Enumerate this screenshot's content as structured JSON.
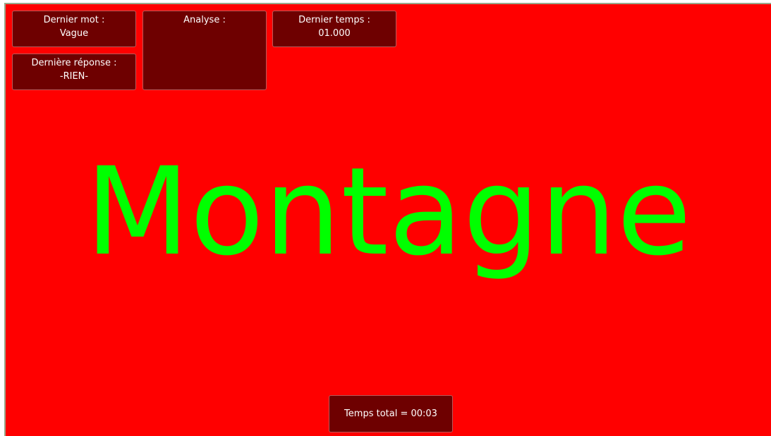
{
  "colors": {
    "background": "#ff0000",
    "panel": "#6e0000",
    "panel_border": "#b85a5a",
    "panel_text": "#ffffff",
    "word": "#00ff00"
  },
  "panels": {
    "last_word": {
      "label": "Dernier mot :",
      "value": "Vague"
    },
    "last_answer": {
      "label": "Dernière réponse :",
      "value": "-RIEN-"
    },
    "analysis": {
      "label": "Analyse :",
      "value": ""
    },
    "last_time": {
      "label": "Dernier temps :",
      "value": "01.000"
    },
    "total_time": {
      "text": "Temps total = 00:03"
    }
  },
  "current_word": "Montagne"
}
